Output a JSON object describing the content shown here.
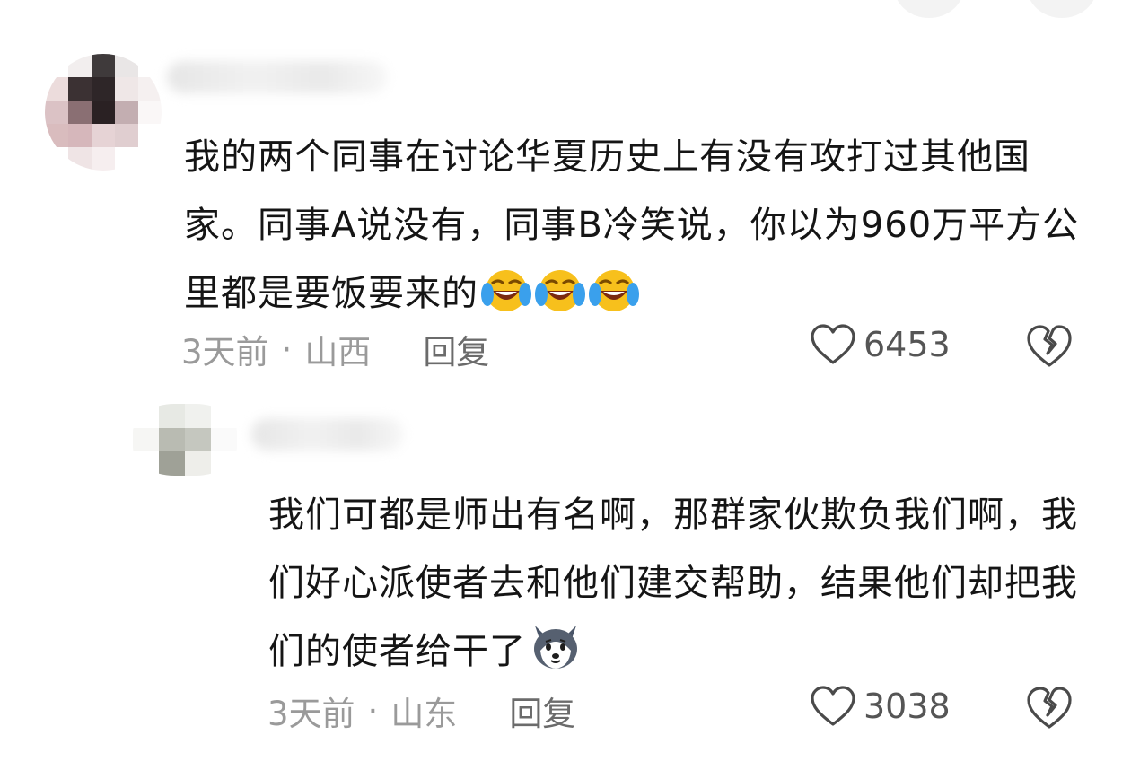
{
  "comments": [
    {
      "text": "我的两个同事在讨论华夏历史上有没有攻打过其他国家。同事A说没有，同事B冷笑说，你以为960万平方公里都是要饭要来的",
      "emoji": "laughing-crying-emoji",
      "emoji_count": 3,
      "time": "3天前",
      "separator": "·",
      "location": "山西",
      "reply_label": "回复",
      "likes": "6453"
    },
    {
      "text": "我们可都是师出有名啊，那群家伙欺负我们啊，我们好心派使者去和他们建交帮助，结果他们却把我们的使者给干了",
      "emoji": "husky-dog-emoji",
      "emoji_count": 1,
      "time": "3天前",
      "separator": "·",
      "location": "山东",
      "reply_label": "回复",
      "likes": "3038"
    }
  ],
  "icons": {
    "like": "heart-outline-icon",
    "dislike": "broken-heart-icon"
  },
  "colors": {
    "text": "#151515",
    "meta": "#9a9a9a",
    "reply": "#6b6b6b",
    "emoji_face": "#f7c01c",
    "emoji_tear": "#3aa0ec"
  }
}
